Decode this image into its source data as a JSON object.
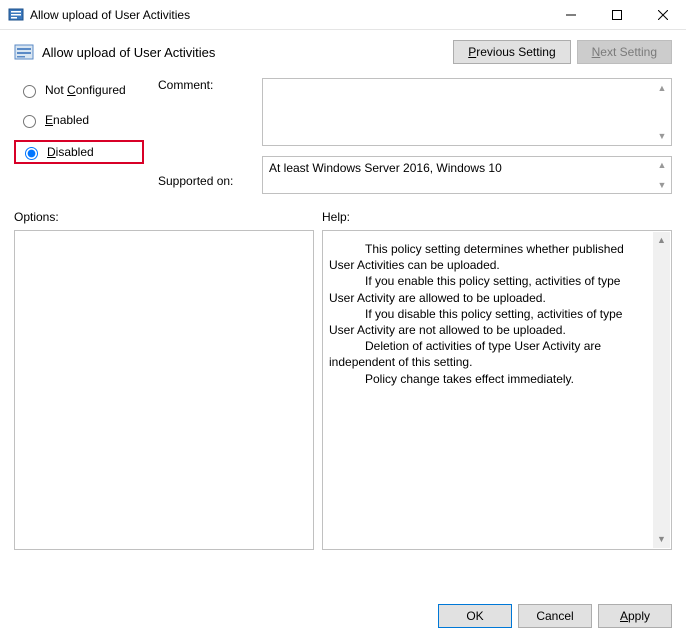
{
  "window": {
    "title": "Allow upload of User Activities"
  },
  "header": {
    "policy_title": "Allow upload of User Activities",
    "prev_prefix": "P",
    "prev_rest": "revious Setting",
    "next_prefix": "N",
    "next_rest": "ext Setting"
  },
  "state": {
    "not_configured_prefix": "C",
    "not_configured_pre": "Not ",
    "not_configured_post": "onfigured",
    "enabled_prefix": "E",
    "enabled_rest": "nabled",
    "disabled_prefix": "D",
    "disabled_rest": "isabled",
    "selected": "disabled"
  },
  "labels": {
    "comment": "Comment:",
    "supported_on": "Supported on:",
    "options": "Options:",
    "help": "Help:"
  },
  "fields": {
    "comment_value": "",
    "supported_text": "At least Windows Server 2016, Windows 10"
  },
  "help": {
    "p1": "This policy setting determines whether published User Activities can be uploaded.",
    "p2": "If you enable this policy setting, activities of type User Activity are allowed to be uploaded.",
    "p3": "If you disable this policy setting, activities of type User Activity are not allowed to be uploaded.",
    "p4": "Deletion of activities of type User Activity are independent of this setting.",
    "p5": "Policy change takes effect immediately."
  },
  "footer": {
    "ok": "OK",
    "cancel": "Cancel",
    "apply_prefix": "A",
    "apply_rest": "pply"
  }
}
